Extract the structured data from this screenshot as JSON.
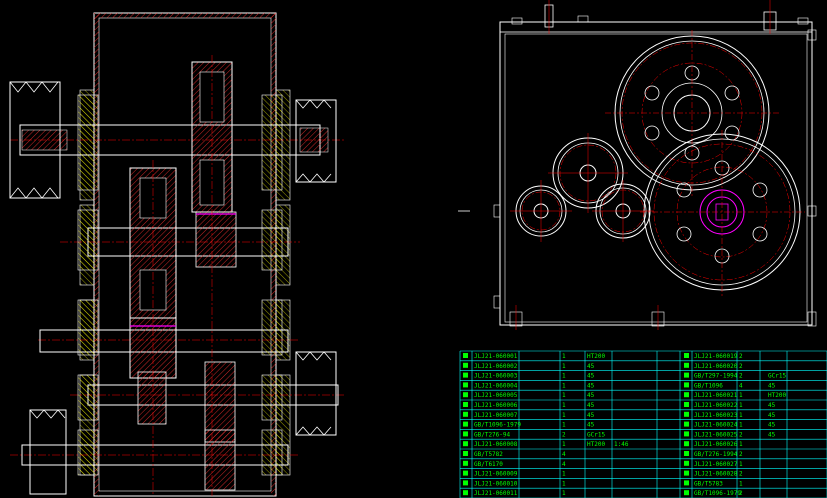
{
  "drawing": {
    "colors": {
      "background": "#000000",
      "outline": "#ffffff",
      "section": "#ffff00",
      "hatch": "#ff3030",
      "centerline": "#ff0000",
      "shaft_magenta": "#ff00ff",
      "table_grid": "#00ffff",
      "table_text": "#00ff00"
    },
    "views": [
      "section-view",
      "side-view",
      "parts-list"
    ]
  },
  "parts_list": {
    "rows": [
      [
        "JLJ21-060001",
        "",
        "1",
        "HT200",
        "",
        "JLJ21-060019",
        "",
        "2",
        ""
      ],
      [
        "JLJ21-060002",
        "",
        "1",
        "45",
        "",
        "JLJ21-060020",
        "",
        "2",
        ""
      ],
      [
        "JLJ21-060003",
        "",
        "1",
        "45",
        "",
        "GB/T297-1994",
        "",
        "2",
        "GCr15"
      ],
      [
        "JLJ21-060004",
        "",
        "1",
        "45",
        "",
        "GB/T1096",
        "",
        "4",
        "45"
      ],
      [
        "JLJ21-060005",
        "",
        "1",
        "45",
        "",
        "JLJ21-060021",
        "",
        "1",
        "HT200"
      ],
      [
        "JLJ21-060006",
        "",
        "1",
        "45",
        "",
        "JLJ21-060022",
        "",
        "1",
        "45"
      ],
      [
        "JLJ21-060007",
        "",
        "1",
        "45",
        "",
        "JLJ21-060023",
        "",
        "1",
        "45"
      ],
      [
        "GB/T1096-1979",
        "",
        "1",
        "45",
        "",
        "JLJ21-060024",
        "",
        "1",
        "45"
      ],
      [
        "GB/T276-94",
        "",
        "2",
        "GCr15",
        "",
        "JLJ21-060025",
        "",
        "2",
        "45"
      ],
      [
        "JLJ21-060008",
        "",
        "1",
        "HT200",
        "1:46",
        "JLJ21-060026",
        "",
        "1",
        ""
      ],
      [
        "GB/T5782",
        "",
        "4",
        "",
        "",
        "GB/T276-1994",
        "",
        "2",
        ""
      ],
      [
        "GB/T6170",
        "",
        "4",
        "",
        "",
        "JLJ21-060027",
        "",
        "1",
        ""
      ],
      [
        "JLJ21-060009",
        "",
        "1",
        "",
        "",
        "JLJ21-060028",
        "",
        "2",
        ""
      ],
      [
        "JLJ21-060010",
        "",
        "1",
        "",
        "",
        "GB/T5783",
        "",
        "1",
        ""
      ],
      [
        "JLJ21-060011",
        "",
        "1",
        "",
        "",
        "GB/T1096-1979",
        "",
        "2",
        ""
      ]
    ]
  }
}
